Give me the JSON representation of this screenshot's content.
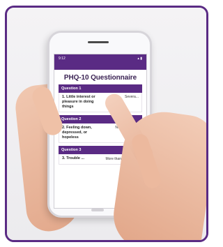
{
  "phone": {
    "status_time": "9:12",
    "status_icons": "▴ ▮",
    "title": "PHQ-10 Questionnaire"
  },
  "questions": [
    {
      "header": "Question 1",
      "text": "1. Little interest or pleasure in doing things",
      "answer": "Severa..."
    },
    {
      "header": "Question 2",
      "text": "2. Feeling down, depressed, or hopeless",
      "answer": "Nearly every ..."
    },
    {
      "header": "Question 3",
      "text": "3. Trouble ...",
      "answer": "More than half..."
    }
  ],
  "colors": {
    "brand": "#5a2b84",
    "accent_check": "#4ab3a8"
  }
}
